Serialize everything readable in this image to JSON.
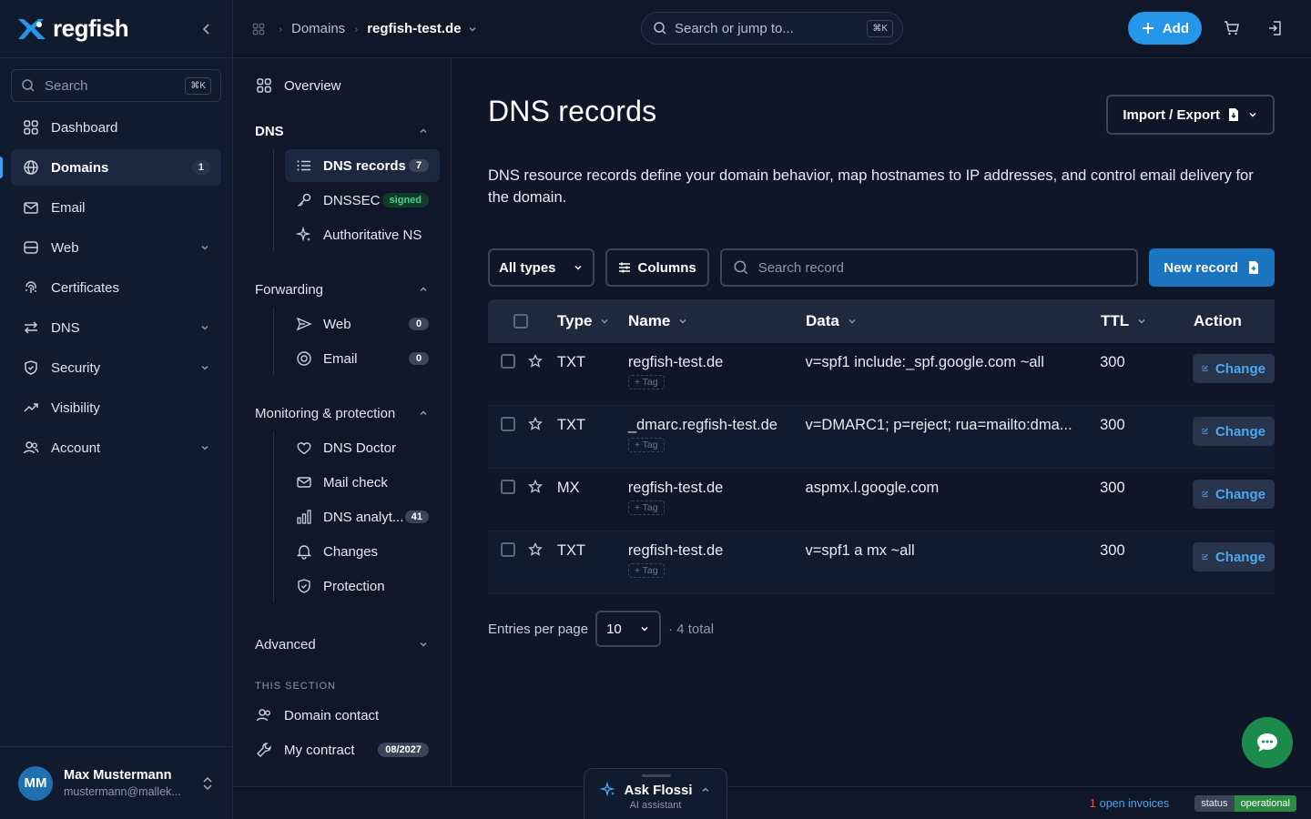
{
  "app": {
    "name": "regfish",
    "brand_color": "#2596e8"
  },
  "sidebar": {
    "search_placeholder": "Search",
    "search_shortcut": "⌘K",
    "items": [
      {
        "label": "Dashboard",
        "icon": "grid-icon"
      },
      {
        "label": "Domains",
        "icon": "globe-icon",
        "badge": "1",
        "active": true
      },
      {
        "label": "Email",
        "icon": "mail-icon"
      },
      {
        "label": "Web",
        "icon": "server-icon",
        "expandable": true
      },
      {
        "label": "Certificates",
        "icon": "fingerprint-icon"
      },
      {
        "label": "DNS",
        "icon": "arrows-icon",
        "expandable": true
      },
      {
        "label": "Security",
        "icon": "shield-icon",
        "expandable": true
      },
      {
        "label": "Visibility",
        "icon": "trend-icon"
      },
      {
        "label": "Account",
        "icon": "users-icon",
        "expandable": true
      }
    ],
    "user": {
      "initials": "MM",
      "name": "Max Mustermann",
      "email": "mustermann@mallek..."
    }
  },
  "topbar": {
    "breadcrumb": {
      "section": "Domains",
      "current": "regfish-test.de"
    },
    "search_placeholder": "Search or jump to...",
    "search_shortcut": "⌘K",
    "add_label": "Add"
  },
  "subnav": {
    "overview": "Overview",
    "dns": {
      "title": "DNS",
      "items": [
        {
          "label": "DNS records",
          "count": "7"
        },
        {
          "label": "DNSSEC",
          "status": "signed"
        },
        {
          "label": "Authoritative NS"
        }
      ]
    },
    "forwarding": {
      "title": "Forwarding",
      "items": [
        {
          "label": "Web",
          "count": "0"
        },
        {
          "label": "Email",
          "count": "0"
        }
      ]
    },
    "monitoring": {
      "title": "Monitoring & protection",
      "items": [
        {
          "label": "DNS Doctor"
        },
        {
          "label": "Mail check"
        },
        {
          "label": "DNS analyt...",
          "count": "41"
        },
        {
          "label": "Changes"
        },
        {
          "label": "Protection"
        }
      ]
    },
    "advanced": {
      "title": "Advanced"
    },
    "this_section": {
      "title": "THIS SECTION",
      "items": [
        {
          "label": "Domain contact"
        },
        {
          "label": "My contract",
          "badge": "08/2027"
        }
      ]
    }
  },
  "main": {
    "title": "DNS records",
    "import_export_label": "Import / Export",
    "description": "DNS resource records define your domain behavior, map hostnames to IP addresses, and control email delivery for the domain.",
    "toolbar": {
      "type_filter": "All types",
      "columns_label": "Columns",
      "search_placeholder": "Search record",
      "new_record_label": "New record"
    },
    "table": {
      "headers": {
        "type": "Type",
        "name": "Name",
        "data": "Data",
        "ttl": "TTL",
        "action": "Action"
      },
      "tag_label": "+ Tag",
      "change_label": "Change",
      "rows": [
        {
          "type": "TXT",
          "name": "regfish-test.de",
          "data": "v=spf1 include:_spf.google.com ~all",
          "ttl": "300"
        },
        {
          "type": "TXT",
          "name": "_dmarc.regfish-test.de",
          "data": "v=DMARC1; p=reject; rua=mailto:dma...",
          "ttl": "300"
        },
        {
          "type": "MX",
          "name": "regfish-test.de",
          "data": "aspmx.l.google.com",
          "ttl": "300"
        },
        {
          "type": "TXT",
          "name": "regfish-test.de",
          "data": "v=spf1 a mx ~all",
          "ttl": "300"
        }
      ]
    },
    "pager": {
      "label": "Entries per page",
      "per_page": "10",
      "total": "· 4 total"
    }
  },
  "assistant": {
    "title": "Ask Flossi",
    "subtitle": "AI assistant"
  },
  "footer": {
    "invoices_count": "1",
    "invoices_text": "open invoices",
    "status_label": "status",
    "status_value": "operational",
    "status_color": "#2c8a45"
  }
}
